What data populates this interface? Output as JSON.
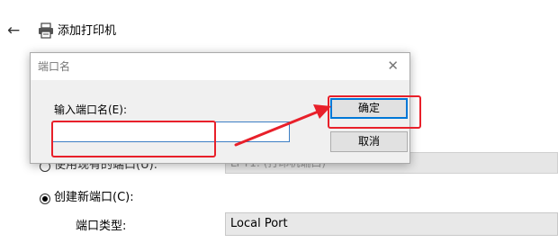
{
  "wizard": {
    "title": "添加打印机",
    "back_icon": "arrow-left-icon",
    "printer_icon": "printer-icon",
    "use_existing_label": "使用现有的端口(U):",
    "existing_port_value": "LPT1: (打印机端口)",
    "create_new_label": "创建新端口(C):",
    "port_type_label": "端口类型:",
    "port_type_value": "Local Port"
  },
  "dialog": {
    "title": "端口名",
    "field_label": "输入端口名(E):",
    "input_value": "",
    "ok_label": "确定",
    "cancel_label": "取消",
    "close_icon": "close-icon"
  },
  "colors": {
    "annotation": "#e8202a",
    "accent": "#0078d7"
  }
}
